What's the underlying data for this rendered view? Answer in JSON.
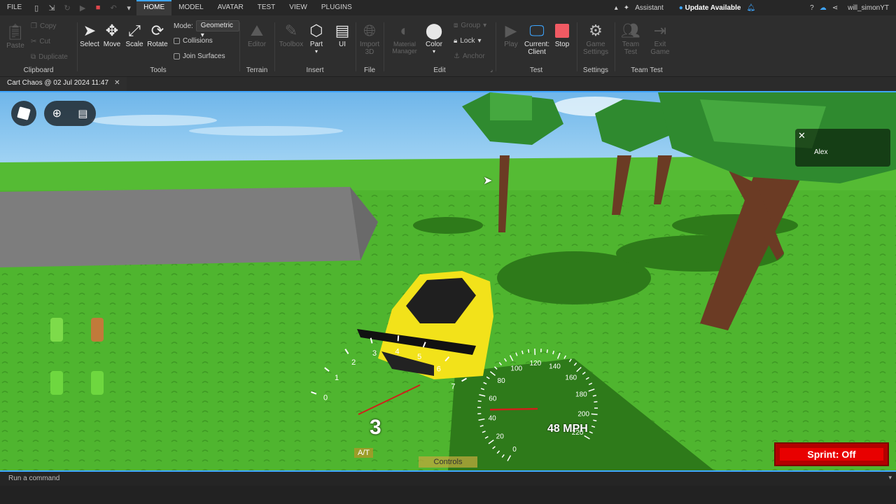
{
  "menubar": {
    "file": "FILE",
    "tabs": [
      "HOME",
      "MODEL",
      "AVATAR",
      "TEST",
      "VIEW",
      "PLUGINS"
    ],
    "active_tab": "HOME",
    "assistant": "Assistant",
    "update": "Update Available",
    "username": "will_simonYT"
  },
  "ribbon": {
    "clipboard": {
      "label": "Clipboard",
      "paste": "Paste",
      "copy": "Copy",
      "cut": "Cut",
      "duplicate": "Duplicate"
    },
    "tools": {
      "label": "Tools",
      "select": "Select",
      "move": "Move",
      "scale": "Scale",
      "rotate": "Rotate",
      "mode_label": "Mode:",
      "mode_value": "Geometric",
      "collisions": "Collisions",
      "join_surfaces": "Join Surfaces"
    },
    "terrain": {
      "label": "Terrain",
      "editor": "Editor"
    },
    "insert": {
      "label": "Insert",
      "toolbox": "Toolbox",
      "part": "Part",
      "ui": "UI"
    },
    "file": {
      "label": "File",
      "import": "Import 3D"
    },
    "edit": {
      "label": "Edit",
      "material": "Material Manager",
      "color": "Color",
      "group": "Group",
      "lock": "Lock",
      "anchor": "Anchor"
    },
    "test": {
      "label": "Test",
      "play": "Play",
      "current": "Current:",
      "client": "Client",
      "stop": "Stop"
    },
    "settings": {
      "label": "Settings",
      "game": "Game Settings"
    },
    "team": {
      "label": "Team Test",
      "team_test": "Team Test",
      "exit_game": "Exit Game"
    }
  },
  "doc_tab": {
    "title": "Cart Chaos @ 02 Jul 2024 11:47"
  },
  "viewport": {
    "player_card": "Alex",
    "tach_ticks": [
      "0",
      "1",
      "2",
      "3",
      "4",
      "5",
      "6",
      "7"
    ],
    "speedo_ticks": [
      "0",
      "20",
      "40",
      "60",
      "80",
      "100",
      "120",
      "140",
      "160",
      "180",
      "200",
      "220"
    ],
    "gear": "3",
    "transmission": "A/T",
    "speed": "48 MPH",
    "speed_value_mph": 48,
    "controls": "Controls",
    "sprint": "Sprint: Off"
  },
  "command_bar": {
    "placeholder": "Run a command"
  },
  "colors": {
    "accent": "#3ea6ff",
    "stop": "#e0474c",
    "sprint": "#e80000",
    "car": "#f2e21a",
    "grass": "#4fb52f",
    "sky": "#7fc4ee"
  }
}
